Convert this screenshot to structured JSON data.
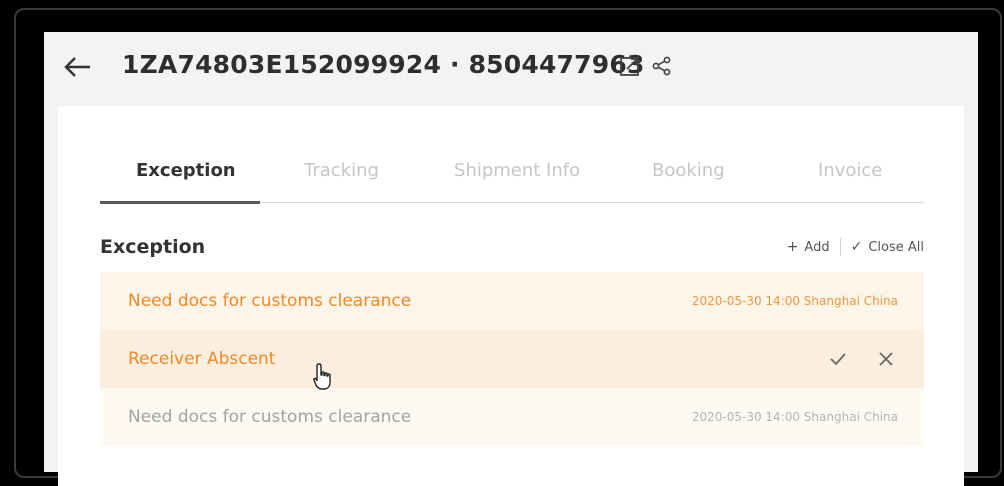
{
  "header": {
    "title": "1ZA74803E152099924 · 8504477963"
  },
  "tabs": [
    {
      "label": "Exception",
      "active": true
    },
    {
      "label": "Tracking",
      "active": false
    },
    {
      "label": "Shipment Info",
      "active": false
    },
    {
      "label": "Booking",
      "active": false
    },
    {
      "label": "Invoice",
      "active": false
    }
  ],
  "section": {
    "title": "Exception",
    "add_label": "Add",
    "close_all_label": "Close All"
  },
  "exceptions": [
    {
      "title": "Need docs for customs clearance",
      "meta": "2020-05-30 14:00 Shanghai China",
      "state": "active"
    },
    {
      "title": "Receiver Abscent",
      "meta": "",
      "state": "hover"
    },
    {
      "title": "Need docs for customs clearance",
      "meta": "2020-05-30 14:00 Shanghai China",
      "state": "closed"
    }
  ],
  "colors": {
    "accent_orange": "#f08a24",
    "row_active_bg": "#fdf5ea",
    "row_hover_bg": "#fbeede",
    "row_closed_bg": "#fdfaf4"
  },
  "icons": {
    "back": "arrow-left-icon",
    "open": "external-link-icon",
    "share": "share-icon",
    "add": "plus-icon",
    "close_all": "check-icon",
    "row_confirm": "check-icon",
    "row_dismiss": "close-icon",
    "cursor": "hand-pointer-icon"
  }
}
